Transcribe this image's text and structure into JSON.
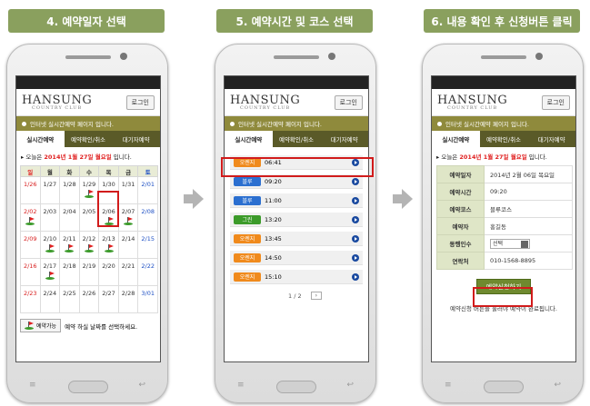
{
  "steps": [
    {
      "title": "4. 예약일자 선택"
    },
    {
      "title": "5. 예약시간 및 코스 선택"
    },
    {
      "title": "6. 내용 확인 후 신청버튼 클릭"
    }
  ],
  "common": {
    "logo_text": "HANSUNG",
    "logo_sub": "COUNTRY CLUB",
    "login": "로그인",
    "notice": "인터넷 실시간예약 페이지 입니다.",
    "tabs": [
      "실시간예약",
      "예약확인/취소",
      "대기자예약"
    ],
    "today_prefix": "오늘은",
    "today_date": "2014년 1월 27일 월요일",
    "today_suffix": "입니다."
  },
  "calendar": {
    "weekdays": [
      "일",
      "월",
      "화",
      "수",
      "목",
      "금",
      "토"
    ],
    "weeks": [
      [
        "1/26",
        "1/27",
        "1/28",
        "1/29",
        "1/30",
        "1/31",
        "2/01"
      ],
      [
        "2/02",
        "2/03",
        "2/04",
        "2/05",
        "2/06",
        "2/07",
        "2/08"
      ],
      [
        "2/09",
        "2/10",
        "2/11",
        "2/12",
        "2/13",
        "2/14",
        "2/15"
      ],
      [
        "2/16",
        "2/17",
        "2/18",
        "2/19",
        "2/20",
        "2/21",
        "2/22"
      ],
      [
        "2/23",
        "2/24",
        "2/25",
        "2/26",
        "2/27",
        "2/28",
        "3/01"
      ]
    ],
    "available": [
      "1/29",
      "2/02",
      "2/06",
      "2/07",
      "2/10",
      "2/11",
      "2/12",
      "2/13",
      "2/17"
    ],
    "selected": "2/06",
    "legend_badge": "예약가능",
    "legend_text": "예약 하실 날짜를 선택하세요."
  },
  "slots": {
    "items": [
      {
        "course": "오렌지",
        "time": "06:41",
        "color": "#f08a1c"
      },
      {
        "course": "블루",
        "time": "09:20",
        "color": "#2b6fd0"
      },
      {
        "course": "블루",
        "time": "11:00",
        "color": "#2b6fd0"
      },
      {
        "course": "그린",
        "time": "13:20",
        "color": "#3c9b2a"
      },
      {
        "course": "오렌지",
        "time": "13:45",
        "color": "#f08a1c"
      },
      {
        "course": "오렌지",
        "time": "14:50",
        "color": "#f08a1c"
      },
      {
        "course": "오렌지",
        "time": "15:10",
        "color": "#f08a1c"
      }
    ],
    "selected_index": 1,
    "pager": "1 / 2",
    "pager_next": "›"
  },
  "confirm": {
    "rows": [
      {
        "label": "예약일자",
        "value": "2014년 2월 06일 목요일"
      },
      {
        "label": "예약시간",
        "value": "09:20"
      },
      {
        "label": "예약코스",
        "value": "블루코스"
      },
      {
        "label": "예약자",
        "value": "홍길동"
      },
      {
        "label": "동행인수",
        "value": "선택"
      },
      {
        "label": "연락처",
        "value": "010-1568-8895"
      }
    ],
    "apply_button": "예약신청하기",
    "hint": "예약신청 버튼을 눌러야 예약이 완료됩니다."
  },
  "colors": {
    "accent": "#8aa05e",
    "notice_bar": "#8f8a3c",
    "tab_bar": "#5a5a28",
    "highlight": "#d11b1b"
  }
}
